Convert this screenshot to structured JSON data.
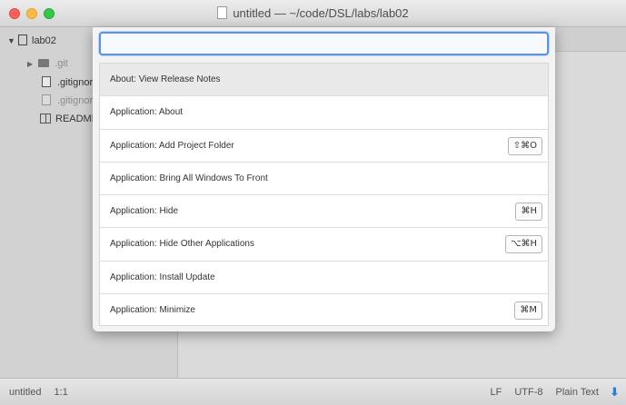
{
  "window": {
    "title": "untitled — ~/code/DSL/labs/lab02"
  },
  "sidebar": {
    "root": "lab02",
    "items": [
      {
        "label": ".git",
        "icon": "folder-icon"
      },
      {
        "label": ".gitignore",
        "icon": "file-icon"
      },
      {
        "label": ".gitignore",
        "icon": "file-icon"
      },
      {
        "label": "README",
        "icon": "readme-icon"
      }
    ]
  },
  "palette": {
    "query": "",
    "placeholder": "",
    "commands": [
      {
        "label": "About: View Release Notes",
        "shortcut": ""
      },
      {
        "label": "Application: About",
        "shortcut": ""
      },
      {
        "label": "Application: Add Project Folder",
        "shortcut": "⇧⌘O"
      },
      {
        "label": "Application: Bring All Windows To Front",
        "shortcut": ""
      },
      {
        "label": "Application: Hide",
        "shortcut": "⌘H"
      },
      {
        "label": "Application: Hide Other Applications",
        "shortcut": "⌥⌘H"
      },
      {
        "label": "Application: Install Update",
        "shortcut": ""
      },
      {
        "label": "Application: Minimize",
        "shortcut": "⌘M"
      }
    ]
  },
  "statusbar": {
    "file": "untitled",
    "cursor": "1:1",
    "line_ending": "LF",
    "encoding": "UTF-8",
    "grammar": "Plain Text"
  },
  "colors": {
    "accent": "#5a94e6",
    "update_icon": "#2a7fd4"
  }
}
